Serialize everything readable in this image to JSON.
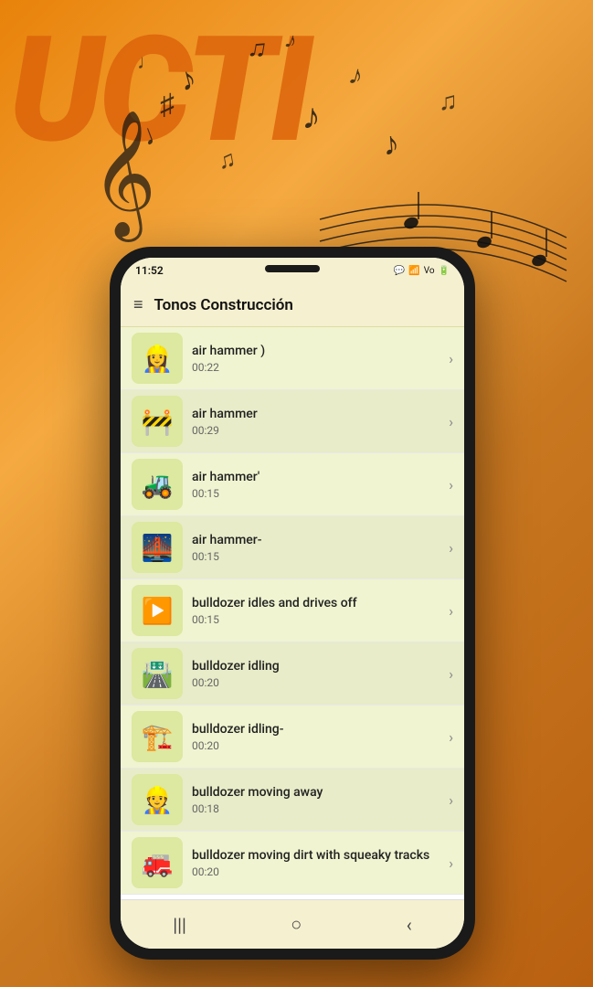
{
  "background": {
    "text": "UCTI"
  },
  "status_bar": {
    "time": "11:52",
    "icons": "📶 🔋"
  },
  "header": {
    "title": "Tonos Construcción",
    "menu_icon": "≡"
  },
  "sound_items": [
    {
      "id": 1,
      "icon": "👷",
      "name": "air hammer )",
      "duration": "00:22"
    },
    {
      "id": 2,
      "icon": "🚧",
      "name": "air hammer",
      "duration": "00:29"
    },
    {
      "id": 3,
      "icon": "🚜",
      "name": "air hammer'",
      "duration": "00:15"
    },
    {
      "id": 4,
      "icon": "🌉",
      "name": "air hammer-",
      "duration": "00:15"
    },
    {
      "id": 5,
      "icon": "▶️",
      "name": "bulldozer idles and drives off",
      "duration": "00:15"
    },
    {
      "id": 6,
      "icon": "🛣️",
      "name": "bulldozer idling",
      "duration": "00:20"
    },
    {
      "id": 7,
      "icon": "🏗️",
      "name": "bulldozer idling-",
      "duration": "00:20"
    },
    {
      "id": 8,
      "icon": "👷",
      "name": "bulldozer moving away",
      "duration": "00:18"
    },
    {
      "id": 9,
      "icon": "🚒",
      "name": "bulldozer moving dirt with squeaky tracks",
      "duration": "00:20"
    }
  ],
  "bottom_nav": {
    "menu_label": "|||",
    "home_label": "○",
    "back_label": "‹"
  }
}
